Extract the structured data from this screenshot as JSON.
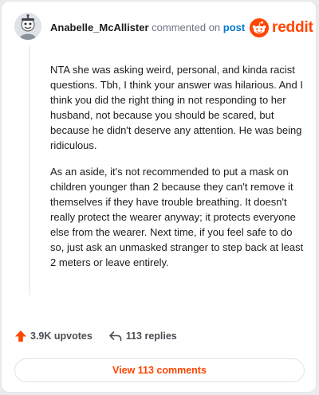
{
  "header": {
    "username": "Anabelle_McAllister",
    "commented_on": "commented on",
    "post_link": "post",
    "brand": "reddit"
  },
  "comment": {
    "paragraphs": [
      "NTA she was asking weird, personal, and kinda racist questions. Tbh, I think your answer was hilarious. And I think you did the right thing in not responding to her husband, not because you should be scared, but because he didn't deserve any attention. He was being ridiculous.",
      "As an aside, it's not recommended to put a mask on children younger than 2 because they can't remove it themselves if they have trouble breathing. It doesn't really protect the wearer anyway; it protects everyone else from the wearer. Next time, if you feel safe to do so, just ask an unmasked stranger to step back at least 2 meters or leave entirely."
    ]
  },
  "actions": {
    "upvotes": "3.9K upvotes",
    "replies": "113 replies",
    "upvote_icon": "upvote-arrow-icon",
    "reply_icon": "reply-arrow-icon"
  },
  "view_comments_label": "View 113 comments",
  "colors": {
    "brand": "#ff4500",
    "link": "#0079d3",
    "text": "#1c1c1c",
    "muted": "#6b7280"
  }
}
